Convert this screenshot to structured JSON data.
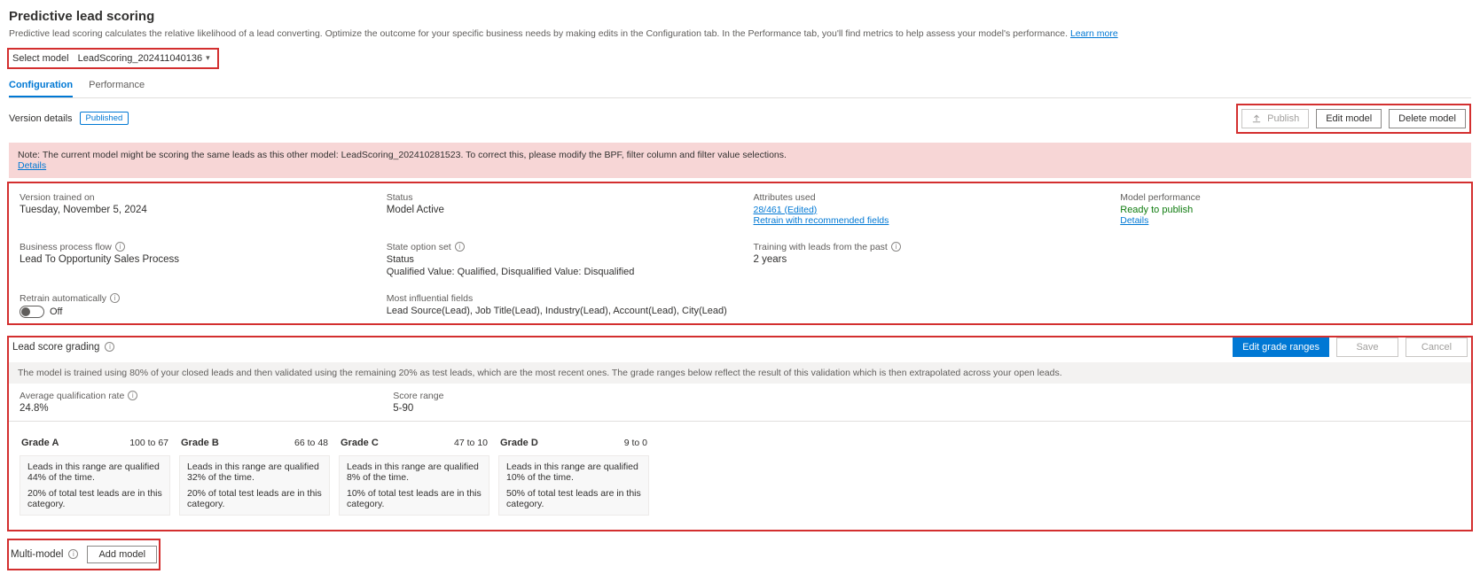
{
  "header": {
    "title": "Predictive lead scoring",
    "description": "Predictive lead scoring calculates the relative likelihood of a lead converting. Optimize the outcome for your specific business needs by making edits in the Configuration tab. In the Performance tab, you'll find metrics to help assess your model's performance. ",
    "learn_more": "Learn more"
  },
  "model_select": {
    "label": "Select model",
    "value": "LeadScoring_202411040136"
  },
  "tabs": {
    "configuration": "Configuration",
    "performance": "Performance"
  },
  "version_details": {
    "label": "Version details",
    "badge": "Published"
  },
  "buttons": {
    "publish": "Publish",
    "edit": "Edit model",
    "delete": "Delete model",
    "edit_grades": "Edit grade ranges",
    "save": "Save",
    "cancel": "Cancel",
    "add_model": "Add model"
  },
  "alert": {
    "text": "Note: The current model might be scoring the same leads as this other model: LeadScoring_202410281523. To correct this, please modify the BPF, filter column and filter value selections.",
    "details": "Details"
  },
  "detail": {
    "trained_on": {
      "label": "Version trained on",
      "value": "Tuesday, November 5, 2024"
    },
    "status": {
      "label": "Status",
      "value": "Model Active"
    },
    "attrs": {
      "label": "Attributes used",
      "value": "28/461 (Edited)",
      "link": "Retrain with recommended fields"
    },
    "perf": {
      "label": "Model performance",
      "value": "Ready to publish",
      "link": "Details"
    },
    "bpf": {
      "label": "Business process flow",
      "value": "Lead To Opportunity Sales Process"
    },
    "state": {
      "label": "State option set",
      "value_line1": "Status",
      "value_line2": "Qualified Value: Qualified, Disqualified Value: Disqualified"
    },
    "training_with": {
      "label": "Training with leads from the past",
      "value": "2 years"
    },
    "retrain": {
      "label": "Retrain automatically",
      "value": "Off"
    },
    "influential": {
      "label": "Most influential fields",
      "value": "Lead Source(Lead), Job Title(Lead), Industry(Lead), Account(Lead), City(Lead)"
    }
  },
  "grading": {
    "section_title": "Lead score grading",
    "info": "The model is trained using 80% of your closed leads and then validated using the remaining 20% as test leads, which are the most recent ones. The grade ranges below reflect the result of this validation which is then extrapolated across your open leads.",
    "avg_label": "Average qualification rate",
    "avg_value": "24.8%",
    "range_label": "Score range",
    "range_value": "5-90",
    "grades": [
      {
        "name": "Grade A",
        "range": "100 to 67",
        "line1": "Leads in this range are qualified 44% of the time.",
        "line2": "20% of total test leads are in this category."
      },
      {
        "name": "Grade B",
        "range": "66 to 48",
        "line1": "Leads in this range are qualified 32% of the time.",
        "line2": "20% of total test leads are in this category."
      },
      {
        "name": "Grade C",
        "range": "47 to 10",
        "line1": "Leads in this range are qualified 8% of the time.",
        "line2": "10% of total test leads are in this category."
      },
      {
        "name": "Grade D",
        "range": "9 to 0",
        "line1": "Leads in this range are qualified 10% of the time.",
        "line2": "50% of total test leads are in this category."
      }
    ]
  },
  "multi_model": {
    "label": "Multi-model"
  }
}
